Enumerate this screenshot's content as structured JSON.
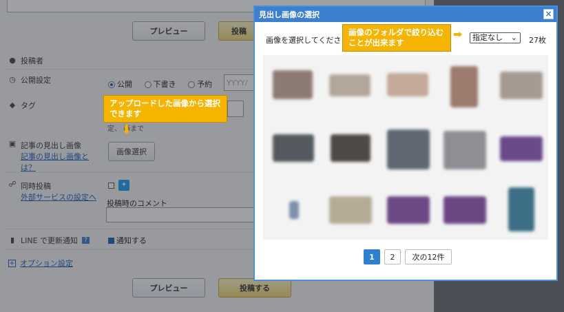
{
  "editor": {
    "preview_label": "プレビュー",
    "post_label": "投稿する",
    "post_label_top": "投稿",
    "author_label": "投稿者",
    "visibility_label": "公開設定",
    "visibility_options": [
      "公開",
      "下書き",
      "予約"
    ],
    "date_placeholder": "YYYY/",
    "tag_label": "タグ",
    "tag_hint": "定、 画まで",
    "featured_image_label": "記事の見出し画像",
    "featured_image_help": "記事の見出し画像とは？",
    "select_image_button": "画像選択",
    "crosspost_label": "同時投稿",
    "external_service_link": "外部サービスの設定へ",
    "crosspost_comment_label": "投稿時のコメント",
    "line_label": "LINE で更新通知",
    "line_help": "?",
    "notify_label": "通知する",
    "options_label": "オプション設定"
  },
  "modal": {
    "title": "見出し画像の選択",
    "close": "×",
    "instruction": "画像を選択してくださ",
    "folder_select_value": "指定なし",
    "count": "27枚",
    "pagination": [
      "1",
      "2",
      "次の12件"
    ]
  },
  "callouts": {
    "folder_tip": "画像のフォルダで絞り込むことが出来ます",
    "upload_tip": "アップロードした画像から選択できます"
  },
  "colors": {
    "accent": "#3c7fcf",
    "callout": "#f5b400",
    "link": "#1d5fb8"
  }
}
